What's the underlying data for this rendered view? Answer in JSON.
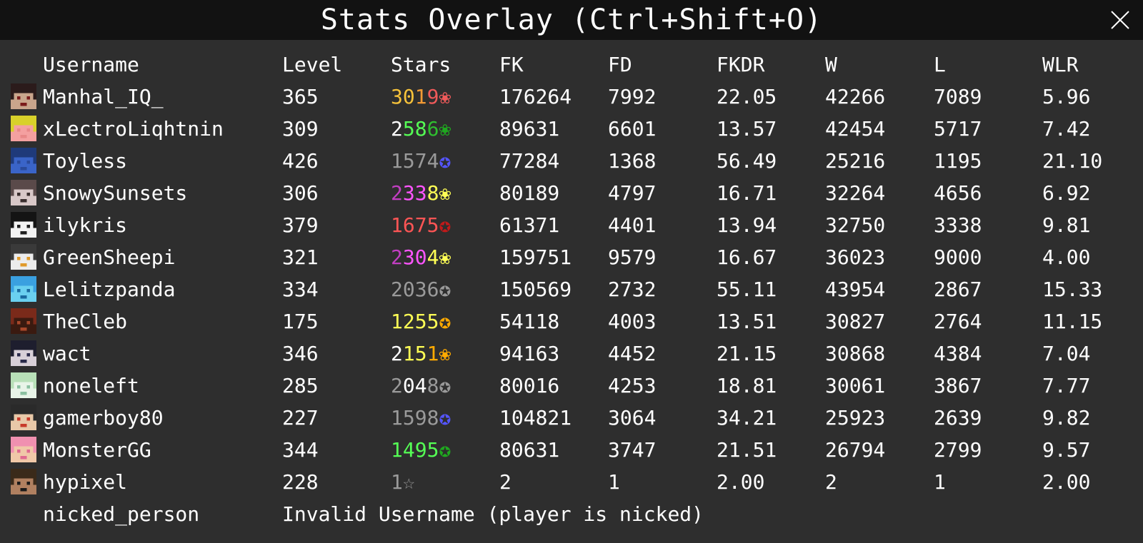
{
  "window": {
    "title": "Stats Overlay (Ctrl+Shift+O)",
    "close_icon": "close-icon"
  },
  "columns": [
    "Username",
    "Level",
    "Stars",
    "FK",
    "FD",
    "FKDR",
    "W",
    "L",
    "WLR"
  ],
  "players": [
    {
      "username": "Manhal_IQ_",
      "level": "365",
      "stars": [
        {
          "t": "3",
          "c": "#f6c23a"
        },
        {
          "t": "0",
          "c": "#f6c23a"
        },
        {
          "t": "1",
          "c": "#f29a34"
        },
        {
          "t": "9",
          "c": "#f05a5a"
        },
        {
          "t": "❀",
          "c": "#f05a5a"
        }
      ],
      "fk": "176264",
      "fd": "7992",
      "fkdr": "22.05",
      "w": "42266",
      "l": "7089",
      "wlr": "5.96",
      "avatar": {
        "a": "#2b1b1b",
        "b": "#c9a58c",
        "c": "#7a1b1b"
      }
    },
    {
      "username": "xLectroLiqhtnin",
      "level": "309",
      "stars": [
        {
          "t": "2",
          "c": "#ffffff"
        },
        {
          "t": "5",
          "c": "#55ff55"
        },
        {
          "t": "8",
          "c": "#55ff55"
        },
        {
          "t": "6",
          "c": "#2fbf2f"
        },
        {
          "t": "❀",
          "c": "#1fa81f"
        }
      ],
      "fk": "89631",
      "fd": "6601",
      "fkdr": "13.57",
      "w": "42454",
      "l": "5717",
      "wlr": "7.42",
      "avatar": {
        "a": "#d8d12a",
        "b": "#f4a0a0",
        "c": "#e88888"
      }
    },
    {
      "username": "Toyless",
      "level": "426",
      "stars": [
        {
          "t": "1574",
          "c": "#9a9a9a"
        },
        {
          "t": "✪",
          "c": "#5555ff"
        }
      ],
      "fk": "77284",
      "fd": "1368",
      "fkdr": "56.49",
      "w": "25216",
      "l": "1195",
      "wlr": "21.10",
      "avatar": {
        "a": "#1f3a7a",
        "b": "#3a64c8",
        "c": "#2a4a9a"
      }
    },
    {
      "username": "SnowySunsets",
      "level": "306",
      "stars": [
        {
          "t": "2",
          "c": "#c23ec2"
        },
        {
          "t": "3",
          "c": "#ff55ff"
        },
        {
          "t": "3",
          "c": "#ff55ff"
        },
        {
          "t": "8",
          "c": "#ffff55"
        },
        {
          "t": "❀",
          "c": "#ffff55"
        }
      ],
      "fk": "80189",
      "fd": "4797",
      "fkdr": "16.71",
      "w": "32264",
      "l": "4656",
      "wlr": "6.92",
      "avatar": {
        "a": "#5a4a4a",
        "b": "#d8c8c8",
        "c": "#3a2e2e"
      }
    },
    {
      "username": "ilykris",
      "level": "379",
      "stars": [
        {
          "t": "1675",
          "c": "#ff5555"
        },
        {
          "t": "✪",
          "c": "#c21a1a"
        }
      ],
      "fk": "61371",
      "fd": "4401",
      "fkdr": "13.94",
      "w": "32750",
      "l": "3338",
      "wlr": "9.81",
      "avatar": {
        "a": "#141414",
        "b": "#f2f2f2",
        "c": "#202020"
      }
    },
    {
      "username": "GreenSheepi",
      "level": "321",
      "stars": [
        {
          "t": "2",
          "c": "#c23ec2"
        },
        {
          "t": "3",
          "c": "#ff55ff"
        },
        {
          "t": "0",
          "c": "#ff55ff"
        },
        {
          "t": "4",
          "c": "#ffff55"
        },
        {
          "t": "❀",
          "c": "#ffff55"
        }
      ],
      "fk": "159751",
      "fd": "9579",
      "fkdr": "16.67",
      "w": "36023",
      "l": "9000",
      "wlr": "4.00",
      "avatar": {
        "a": "#3a3a3a",
        "b": "#ececec",
        "c": "#e09a2a"
      }
    },
    {
      "username": "Lelitzpanda",
      "level": "334",
      "stars": [
        {
          "t": "2036",
          "c": "#9a9a9a"
        },
        {
          "t": "✪",
          "c": "#9a9a9a"
        }
      ],
      "fk": "150569",
      "fd": "2732",
      "fkdr": "55.11",
      "w": "43954",
      "l": "2867",
      "wlr": "15.33",
      "avatar": {
        "a": "#3aa0e0",
        "b": "#6ad0f0",
        "c": "#1a6aa0"
      }
    },
    {
      "username": "TheCleb",
      "level": "175",
      "stars": [
        {
          "t": "1255",
          "c": "#ffff55"
        },
        {
          "t": "✪",
          "c": "#ffaa00"
        }
      ],
      "fk": "54118",
      "fd": "4003",
      "fkdr": "13.51",
      "w": "30827",
      "l": "2764",
      "wlr": "11.15",
      "avatar": {
        "a": "#7a2a1a",
        "b": "#3a1a10",
        "c": "#a8482a"
      }
    },
    {
      "username": "wact",
      "level": "346",
      "stars": [
        {
          "t": "2",
          "c": "#ffffff"
        },
        {
          "t": "1",
          "c": "#ffff55"
        },
        {
          "t": "5",
          "c": "#ffff55"
        },
        {
          "t": "1",
          "c": "#ffaa00"
        },
        {
          "t": "❀",
          "c": "#ffaa00"
        }
      ],
      "fk": "94163",
      "fd": "4452",
      "fkdr": "21.15",
      "w": "30868",
      "l": "4384",
      "wlr": "7.04",
      "avatar": {
        "a": "#1e1e2e",
        "b": "#d8d0d8",
        "c": "#2a2a4a"
      }
    },
    {
      "username": "noneleft",
      "level": "285",
      "stars": [
        {
          "t": "2",
          "c": "#9a9a9a"
        },
        {
          "t": "0",
          "c": "#ffffff"
        },
        {
          "t": "4",
          "c": "#ffffff"
        },
        {
          "t": "8",
          "c": "#9a9a9a"
        },
        {
          "t": "✪",
          "c": "#9a9a9a"
        }
      ],
      "fk": "80016",
      "fd": "4253",
      "fkdr": "18.81",
      "w": "30061",
      "l": "3867",
      "wlr": "7.77",
      "avatar": {
        "a": "#b8e0b8",
        "b": "#e8f4e8",
        "c": "#8ac0a0"
      }
    },
    {
      "username": "gamerboy80",
      "level": "227",
      "stars": [
        {
          "t": "1598",
          "c": "#9a9a9a"
        },
        {
          "t": "✪",
          "c": "#5555ff"
        }
      ],
      "fk": "104821",
      "fd": "3064",
      "fkdr": "34.21",
      "w": "25923",
      "l": "2639",
      "wlr": "9.82",
      "avatar": {
        "a": "#2a2a2a",
        "b": "#e8c8a8",
        "c": "#c83a2a"
      }
    },
    {
      "username": "MonsterGG",
      "level": "344",
      "stars": [
        {
          "t": "1495",
          "c": "#55ff55"
        },
        {
          "t": "✪",
          "c": "#1fa81f"
        }
      ],
      "fk": "80631",
      "fd": "3747",
      "fkdr": "21.51",
      "w": "26794",
      "l": "2799",
      "wlr": "9.57",
      "avatar": {
        "a": "#f090b0",
        "b": "#f0c8a8",
        "c": "#e06a90"
      }
    },
    {
      "username": "hypixel",
      "level": "228",
      "stars": [
        {
          "t": "1",
          "c": "#9a9a9a"
        },
        {
          "t": "☆",
          "c": "#9a9a9a"
        }
      ],
      "fk": "2",
      "fd": "1",
      "fkdr": "2.00",
      "w": "2",
      "l": "1",
      "wlr": "2.00",
      "avatar": {
        "a": "#3a2a1a",
        "b": "#b08060",
        "c": "#1a1a1a"
      }
    }
  ],
  "nicked": {
    "username": "nicked_person",
    "message": "Invalid Username (player is nicked)"
  }
}
